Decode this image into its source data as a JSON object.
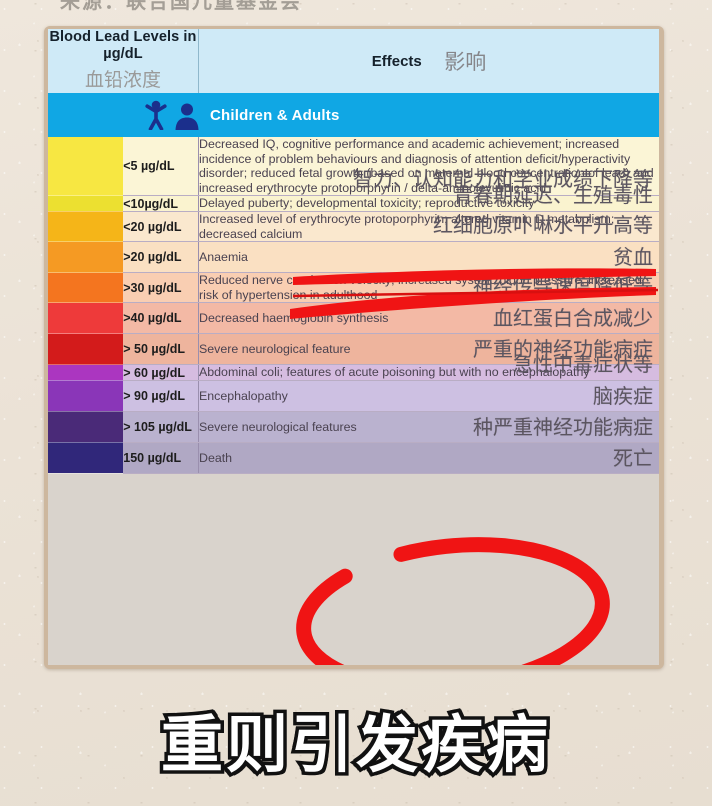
{
  "source_line": "来源：联合国儿童基金会",
  "header": {
    "left_en": "Blood Lead Levels in µg/dL",
    "left_zh": "血铅浓度",
    "right_en": "Effects",
    "right_zh": "影响"
  },
  "band": {
    "label": "Children & Adults",
    "child_icon": "child-icon",
    "adult_icon": "adult-icon",
    "color": "#10a7e4"
  },
  "caption": "重则引发疾病",
  "colors": {
    "backdrop": "#ece4d8",
    "frame": "#cdb79e",
    "header_bg": "#cfeaf7",
    "band_bg": "#10a7e4",
    "marker_red": "#f01414"
  },
  "rows": [
    {
      "level": "<5 µg/dL",
      "swatch": "#f7e742",
      "row_bg": "#fbf5d6",
      "en": "Decreased IQ, cognitive performance and academic achievement; increased incidence of problem behaviours and diagnosis of attention deficit/hyperactivity disorder; reduced fetal growth (based on maternal blood concentration of lead) and increased erythrocyte protoporphyrin / delta-aminolevulinic acid",
      "zh": "智力、认知能力和学业成绩下降等"
    },
    {
      "level": "<10µg/dL",
      "swatch": "#ece030",
      "row_bg": "#faf3cf",
      "en": "Delayed puberty; developmental toxicity; reproductive toxicity",
      "zh": "青春期延迟、生殖毒性"
    },
    {
      "level": "<20 µg/dL",
      "swatch": "#f5b518",
      "row_bg": "#fae8ce",
      "en": "Increased level of erythrocyte protoporphyrin; altered vitamin D metabolism; decreased calcium",
      "zh": "红细胞原卟啉水平升高等"
    },
    {
      "level": ">20 µg/dL",
      "swatch": "#f59a23",
      "row_bg": "#fae0c2",
      "en": "Anaemia",
      "zh": "贫血"
    },
    {
      "level": ">30 µg/dL",
      "swatch": "#f4751f",
      "row_bg": "#f9ceb2",
      "en": "Reduced nerve conduction velocity; increased systolic blood pressure; increased risk of hypertension in adulthood",
      "zh": "神经传导速度降低等"
    },
    {
      "level": ">40 µg/dL",
      "swatch": "#ee3a3a",
      "row_bg": "#f3b9a5",
      "en": "Decreased haemoglobin synthesis",
      "zh": "血红蛋白合成减少"
    },
    {
      "level": "> 50 µg/dL",
      "swatch": "#d31b1b",
      "row_bg": "#eeb49d",
      "en": "Severe neurological feature",
      "zh": "严重的神经功能病症"
    },
    {
      "level": "> 60 µg/dL",
      "swatch": "#ab36c0",
      "row_bg": "#d6bce0",
      "en": "Abdominal coli; features of acute poisoning but with no encephalopathy",
      "zh": "急性中毒症状等"
    },
    {
      "level": "> 90 µg/dL",
      "swatch": "#8a36b8",
      "row_bg": "#cdc0e2",
      "en": "Encephalopathy",
      "zh": "脑疾症"
    },
    {
      "level": "> 105 µg/dL",
      "swatch": "#4a2a78",
      "row_bg": "#bab2cf",
      "en": "Severe neurological features",
      "zh": "种严重神经功能病症"
    },
    {
      "level": "150 µg/dL",
      "swatch": "#30277a",
      "row_bg": "#b0a8c4",
      "en": "Death",
      "zh": "死亡"
    }
  ]
}
